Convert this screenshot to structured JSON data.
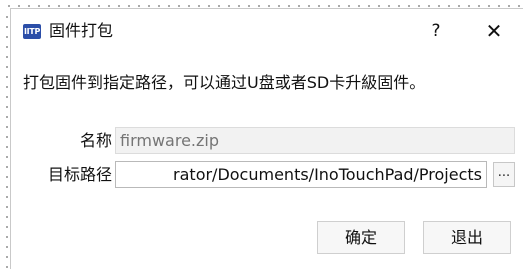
{
  "window": {
    "icon_text": "IITP",
    "title": "固件打包",
    "help_label": "?",
    "close_label": "✕"
  },
  "main": {
    "description": "打包固件到指定路径，可以通过U盘或者SD卡升級固件。",
    "name_label": "名称",
    "name_placeholder": "firmware.zip",
    "name_value": "",
    "path_label": "目标路径",
    "path_value": "rator/Documents/InoTouchPad/Projects",
    "browse_label": "..."
  },
  "footer": {
    "ok_label": "确定",
    "exit_label": "退出"
  },
  "colors": {
    "app_icon_bg": "#2b4ea8",
    "disabled_field_bg": "#f2f2f2",
    "placeholder_text": "#a3a3a3"
  }
}
